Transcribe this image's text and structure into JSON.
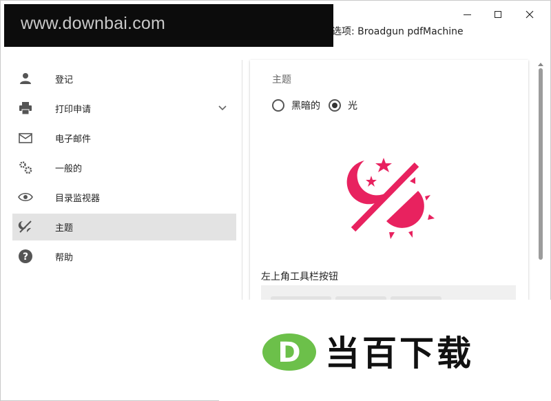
{
  "window": {
    "title": "选项: Broadgun pdfMachine",
    "controls": {
      "minimize": "minimize",
      "maximize": "maximize",
      "close": "close"
    }
  },
  "watermark": {
    "text": "www.downbai.com"
  },
  "sidebar": {
    "items": [
      {
        "label": "登记",
        "icon": "person-icon"
      },
      {
        "label": "打印申请",
        "icon": "printer-icon",
        "expandable": true
      },
      {
        "label": "电子邮件",
        "icon": "mail-icon"
      },
      {
        "label": "一般的",
        "icon": "gears-icon"
      },
      {
        "label": "目录监视器",
        "icon": "eye-icon"
      },
      {
        "label": "主题",
        "icon": "theme-icon",
        "active": true
      },
      {
        "label": "帮助",
        "icon": "help-icon"
      }
    ]
  },
  "content": {
    "section_title": "主题",
    "theme_options": [
      {
        "label": "黑暗的",
        "checked": false
      },
      {
        "label": "光",
        "checked": true
      }
    ],
    "toolbar_title": "左上角工具栏按钮"
  },
  "colors": {
    "accent": "#e8225f",
    "active_bg": "#e3e3e3",
    "logo_green": "#6cc04a"
  },
  "logo": {
    "text": "当百下载",
    "mark_letter": "D"
  }
}
